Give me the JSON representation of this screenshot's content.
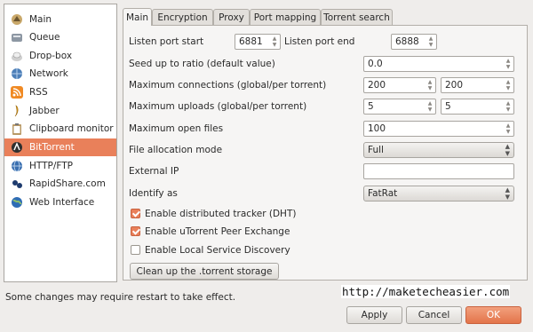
{
  "sidebar": {
    "items": [
      {
        "label": "Main",
        "icon": "main-icon"
      },
      {
        "label": "Queue",
        "icon": "queue-icon"
      },
      {
        "label": "Drop-box",
        "icon": "dropbox-icon"
      },
      {
        "label": "Network",
        "icon": "network-icon"
      },
      {
        "label": "RSS",
        "icon": "rss-icon"
      },
      {
        "label": "Jabber",
        "icon": "jabber-icon"
      },
      {
        "label": "Clipboard monitor",
        "icon": "clipboard-icon"
      },
      {
        "label": "BitTorrent",
        "icon": "bittorrent-icon",
        "selected": true
      },
      {
        "label": "HTTP/FTP",
        "icon": "http-ftp-icon"
      },
      {
        "label": "RapidShare.com",
        "icon": "rapidshare-icon"
      },
      {
        "label": "Web Interface",
        "icon": "web-interface-icon"
      }
    ]
  },
  "tabs": [
    {
      "label": "Main",
      "active": true
    },
    {
      "label": "Encryption"
    },
    {
      "label": "Proxy"
    },
    {
      "label": "Port mapping"
    },
    {
      "label": "Torrent search"
    }
  ],
  "form": {
    "listen_port_start": {
      "label": "Listen port start",
      "value": "6881"
    },
    "listen_port_end": {
      "label": "Listen port end",
      "value": "6888"
    },
    "seed_ratio": {
      "label": "Seed up to ratio (default value)",
      "value": "0.0"
    },
    "max_connections": {
      "label": "Maximum connections (global/per torrent)",
      "global": "200",
      "per_torrent": "200"
    },
    "max_uploads": {
      "label": "Maximum uploads (global/per torrent)",
      "global": "5",
      "per_torrent": "5"
    },
    "max_open_files": {
      "label": "Maximum open files",
      "value": "100"
    },
    "file_allocation": {
      "label": "File allocation mode",
      "value": "Full"
    },
    "external_ip": {
      "label": "External IP",
      "value": ""
    },
    "identify_as": {
      "label": "Identify as",
      "value": "FatRat"
    },
    "dht": {
      "label": "Enable distributed tracker (DHT)",
      "checked": true
    },
    "pex": {
      "label": "Enable uTorrent Peer Exchange",
      "checked": true
    },
    "lsd": {
      "label": "Enable Local Service Discovery",
      "checked": false
    },
    "cleanup_button": "Clean up the .torrent storage"
  },
  "status": "Some changes may require restart to take effect.",
  "watermark": "http://maketecheasier.com",
  "buttons": {
    "apply": "Apply",
    "cancel": "Cancel",
    "ok": "OK"
  },
  "colors": {
    "accent": "#e9805a",
    "background": "#efedeb"
  }
}
